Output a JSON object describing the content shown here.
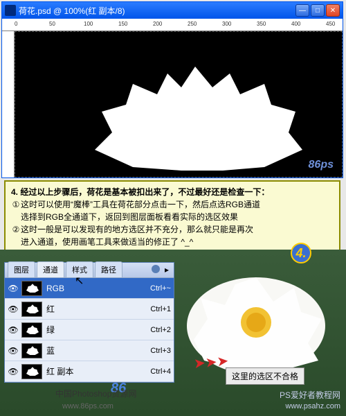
{
  "document": {
    "title": "荷花.psd @ 100%(红 副本/8)",
    "ruler_marks": [
      "0",
      "50",
      "100",
      "150",
      "200",
      "250",
      "300",
      "350",
      "400",
      "450"
    ]
  },
  "instruction": {
    "line0": "4. 经过以上步骤后，荷花是基本被扣出来了，不过最好还是检查一下：",
    "bullet1": "①",
    "line1a": "这时可以使用“魔棒”工具在荷花部分点击一下，然后点选RGB通道",
    "line1b": "选择到RGB全通道下，返回到图层面板看看实际的选区效果",
    "bullet2": "②",
    "line2a": "这时一般是可以发现有的地方选区并不充分，那么就只能是再次",
    "line2b": "进入通道，使用画笔工具来做适当的修正了 ^_^"
  },
  "panel": {
    "tabs": {
      "layers": "图层",
      "channels": "通道",
      "styles": "样式",
      "paths": "路径"
    },
    "rows": [
      {
        "name": "RGB",
        "shortcut": "Ctrl+~"
      },
      {
        "name": "红",
        "shortcut": "Ctrl+1"
      },
      {
        "name": "绿",
        "shortcut": "Ctrl+2"
      },
      {
        "name": "蓝",
        "shortcut": "Ctrl+3"
      },
      {
        "name": "红 副本",
        "shortcut": "Ctrl+4"
      }
    ]
  },
  "step_badge": "4.",
  "selection_label": "这里的选区不合格",
  "watermark": "86ps",
  "logo": "86",
  "footer_cn": "中国Photoshop资源网",
  "footer_url": "www.86ps.com",
  "footer_r1": "PS爱好者教程网",
  "footer_r2": "www.psahz.com"
}
